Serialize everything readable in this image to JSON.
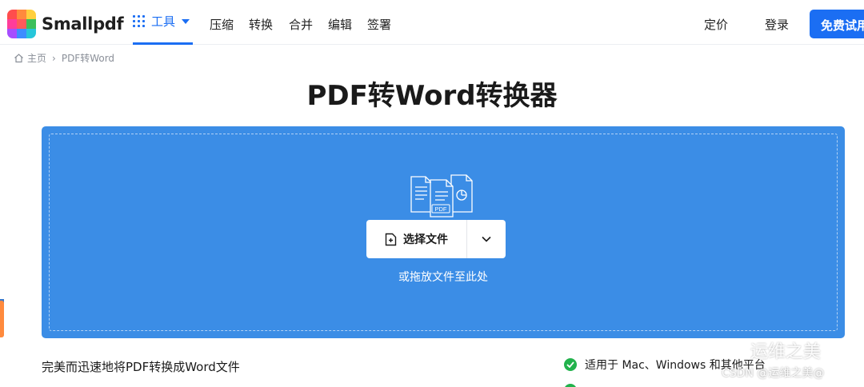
{
  "header": {
    "logo_text": "Smallpdf",
    "tools_label": "工具",
    "nav": [
      "压缩",
      "转换",
      "合并",
      "编辑",
      "签署"
    ],
    "pricing": "定价",
    "login": "登录",
    "trial_button": "免费试用"
  },
  "logo_colors": [
    "#ff4d4d",
    "#ff8a3d",
    "#ffd23d",
    "#ff3d9a",
    "#3bbf5b",
    "#3d8dff",
    "#a64dff",
    "#26c6da",
    "#ff6f3d"
  ],
  "breadcrumb": {
    "home": "主页",
    "current": "PDF转Word"
  },
  "page_title": "PDF转Word转换器",
  "dropzone": {
    "icon_badge": "PDF",
    "choose_button": "选择文件",
    "hint": "或拖放文件至此处"
  },
  "features": {
    "left": "完美而迅速地将PDF转换成Word文件",
    "right": "适用于 Mac、Windows 和其他平台"
  },
  "watermark": {
    "line1": "运维之美",
    "line2": "CSDN @运维之美@"
  }
}
